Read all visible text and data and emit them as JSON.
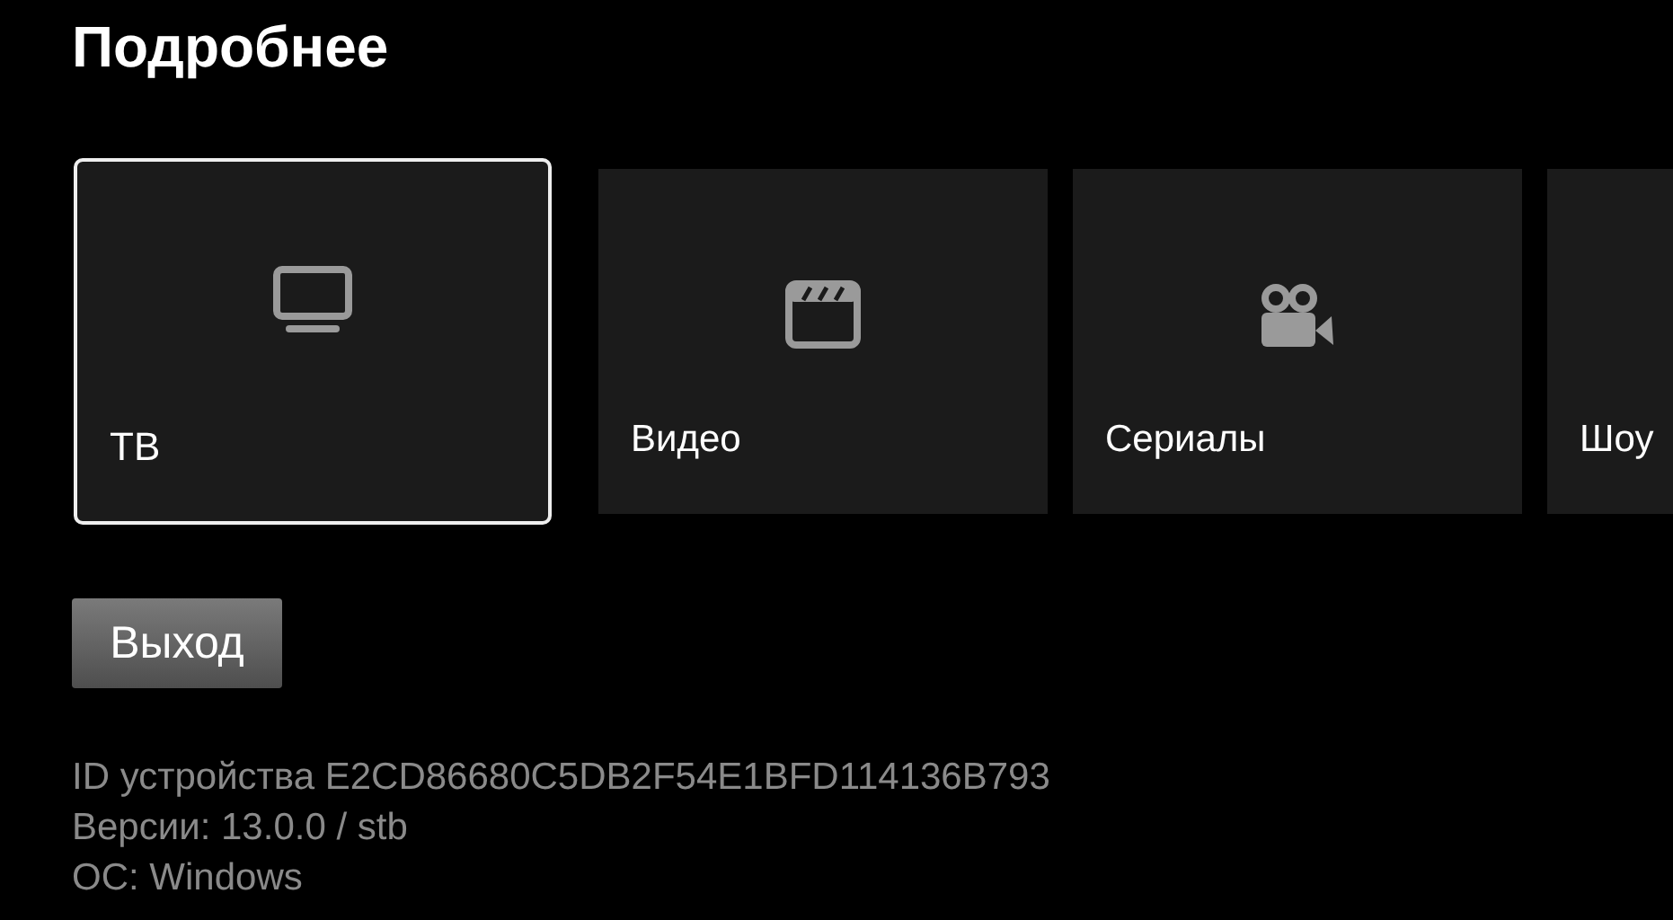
{
  "title": "Подробнее",
  "cards": [
    {
      "label": "ТВ",
      "kind": "tv",
      "selected": true
    },
    {
      "label": "Видео",
      "kind": "video",
      "selected": false
    },
    {
      "label": "Сериалы",
      "kind": "series",
      "selected": false
    },
    {
      "label": "Шоу",
      "selected": false
    }
  ],
  "exit_button": "Выход",
  "info": [
    "ID устройства E2CD86680C5DB2F54E1BFD114136B793",
    "Версии: 13.0.0 / stb",
    "ОС: Windows"
  ]
}
